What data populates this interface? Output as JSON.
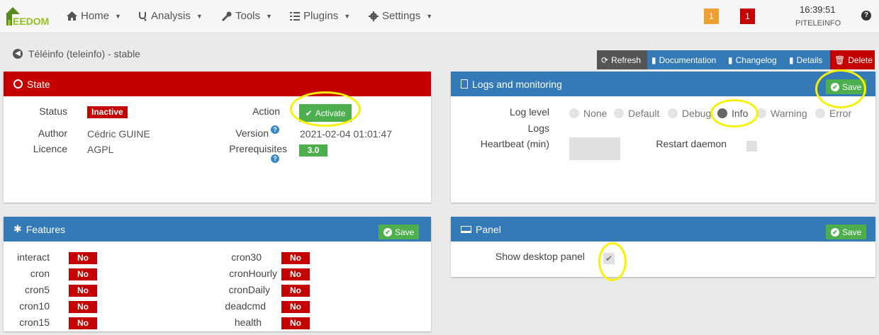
{
  "navbar": {
    "logo_text": "EEDOM",
    "items": [
      {
        "label": "Home",
        "icon": "home-icon"
      },
      {
        "label": "Analysis",
        "icon": "stethoscope-icon"
      },
      {
        "label": "Tools",
        "icon": "wrench-icon"
      },
      {
        "label": "Plugins",
        "icon": "tasks-icon"
      },
      {
        "label": "Settings",
        "icon": "cog-icon"
      }
    ],
    "badge_warning": "1",
    "badge_danger": "1",
    "time": "16:39:51",
    "hostname": "PITELEINFO",
    "colors": {
      "warning": "#f0a030",
      "danger": "#c40000"
    }
  },
  "page": {
    "title": "Téléinfo (teleinfo) - stable",
    "actions": {
      "refresh": "Refresh",
      "documentation": "Documentation",
      "changelog": "Changelog",
      "details": "Details",
      "delete": "Delete"
    }
  },
  "state": {
    "title": "State",
    "status_label": "Status",
    "status_value": "Inactive",
    "author_label": "Author",
    "author_value": "Cédric GUINE",
    "licence_label": "Licence",
    "licence_value": "AGPL",
    "action_label": "Action",
    "activate_label": "Activate",
    "version_label": "Version",
    "version_value": "2021-02-04 01:01:47",
    "prereq_label": "Prerequisites",
    "prereq_value": "3.0"
  },
  "logs": {
    "title": "Logs and monitoring",
    "save_label": "Save",
    "loglevel_label": "Log level",
    "logs_label": "Logs",
    "levels": [
      "None",
      "Default",
      "Debug",
      "Info",
      "Warning",
      "Error"
    ],
    "selected_level": "Info",
    "heartbeat_label": "Heartbeat (min)",
    "restart_label": "Restart daemon"
  },
  "features": {
    "title": "Features",
    "save_label": "Save",
    "left": [
      {
        "name": "interact",
        "value": "No"
      },
      {
        "name": "cron",
        "value": "No"
      },
      {
        "name": "cron5",
        "value": "No"
      },
      {
        "name": "cron10",
        "value": "No"
      },
      {
        "name": "cron15",
        "value": "No"
      }
    ],
    "right": [
      {
        "name": "cron30",
        "value": "No"
      },
      {
        "name": "cronHourly",
        "value": "No"
      },
      {
        "name": "cronDaily",
        "value": "No"
      },
      {
        "name": "deadcmd",
        "value": "No"
      },
      {
        "name": "health",
        "value": "No"
      }
    ]
  },
  "panel": {
    "title": "Panel",
    "save_label": "Save",
    "desktop_label": "Show desktop panel",
    "desktop_checked": true
  }
}
